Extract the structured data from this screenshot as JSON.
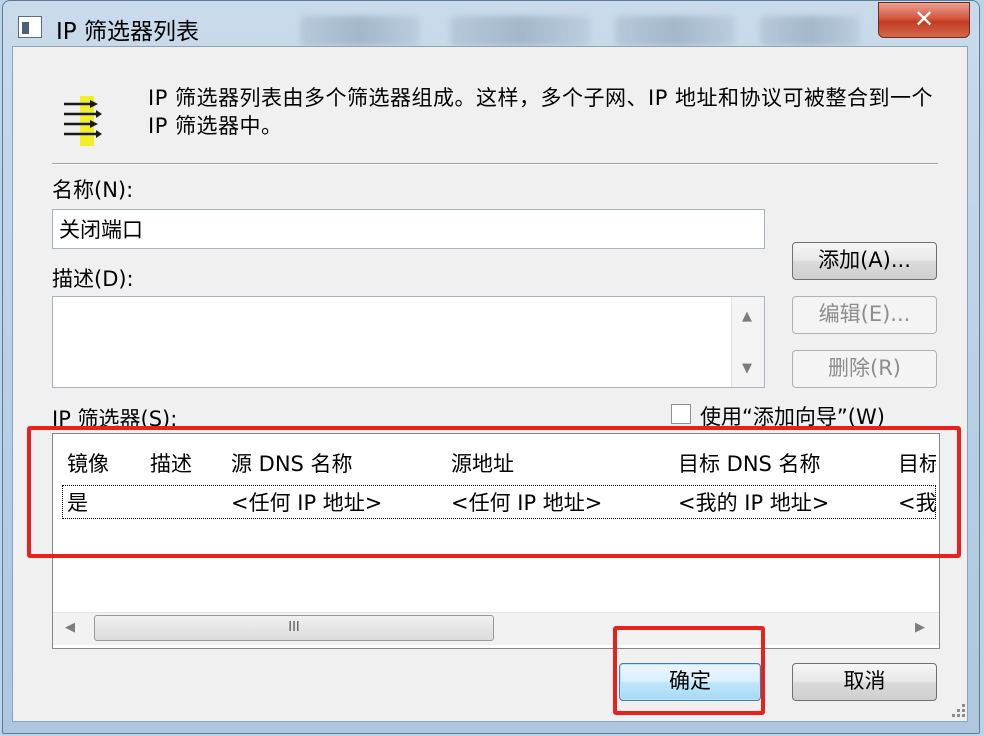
{
  "window": {
    "title": "IP 筛选器列表",
    "close_glyph": "✕"
  },
  "info": {
    "text": "IP 筛选器列表由多个筛选器组成。这样，多个子网、IP 地址和协议可被整合到一个 IP 筛选器中。",
    "icon": "filter-list-icon"
  },
  "name_field": {
    "label": "名称(N):",
    "value": "关闭端口"
  },
  "description_field": {
    "label": "描述(D):",
    "value": ""
  },
  "side_buttons": {
    "add": "添加(A)...",
    "edit": "编辑(E)...",
    "remove": "删除(R)"
  },
  "filters": {
    "label": "IP 筛选器(S):",
    "use_wizard_label": "使用“添加向导”(W)",
    "use_wizard_checked": false,
    "columns": [
      "镜像",
      "描述",
      "源 DNS 名称",
      "源地址",
      "目标 DNS 名称",
      "目标"
    ],
    "rows": [
      [
        "是",
        "",
        "<任何 IP 地址>",
        "<任何 IP 地址>",
        "<我的 IP 地址>",
        "<我"
      ]
    ],
    "scroll_left": "◀",
    "scroll_right": "▶",
    "thumb_grip": "III"
  },
  "footer": {
    "ok": "确定",
    "cancel": "取消"
  },
  "colors": {
    "highlight": "#e8211c",
    "close_button": "#c13b22"
  }
}
